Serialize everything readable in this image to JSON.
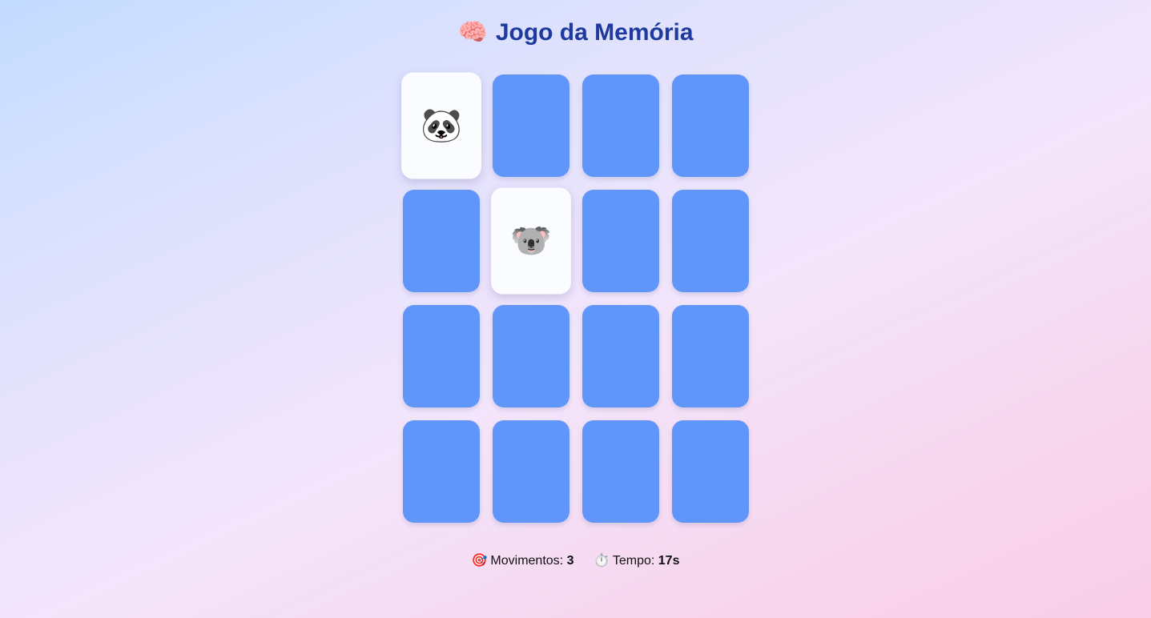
{
  "header": {
    "icon": "🧠",
    "icon_name": "brain-icon",
    "title": "Jogo da Memória"
  },
  "board": {
    "columns": 4,
    "rows": 4,
    "cards": [
      {
        "face": "🐼",
        "flipped": true
      },
      {
        "face": "",
        "flipped": false
      },
      {
        "face": "",
        "flipped": false
      },
      {
        "face": "",
        "flipped": false
      },
      {
        "face": "",
        "flipped": false
      },
      {
        "face": "🐨",
        "flipped": true
      },
      {
        "face": "",
        "flipped": false
      },
      {
        "face": "",
        "flipped": false
      },
      {
        "face": "",
        "flipped": false
      },
      {
        "face": "",
        "flipped": false
      },
      {
        "face": "",
        "flipped": false
      },
      {
        "face": "",
        "flipped": false
      },
      {
        "face": "",
        "flipped": false
      },
      {
        "face": "",
        "flipped": false
      },
      {
        "face": "",
        "flipped": false
      },
      {
        "face": "",
        "flipped": false
      }
    ]
  },
  "stats": {
    "moves_icon": "🎯",
    "moves_label": "Movimentos:",
    "moves_value": "3",
    "time_icon": "⏱️",
    "time_label": "Tempo:",
    "time_value": "17s"
  },
  "colors": {
    "card_back": "#6096f9",
    "card_front": "#fbfcff",
    "title": "#1e3a9e"
  }
}
